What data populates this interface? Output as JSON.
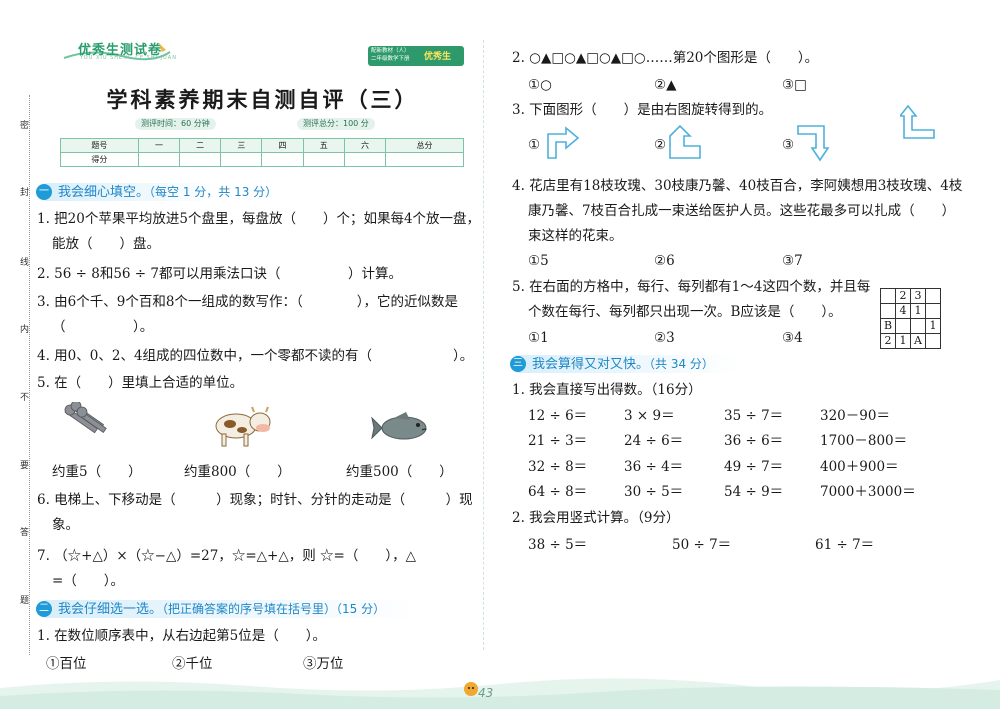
{
  "header": {
    "logo": "优秀生测试卷",
    "logo_sub": "YOU XIU SHENG CE SHI JUAN",
    "badge_left_line1": "配新教材（人）",
    "badge_left_line2": "二年级数学下册",
    "badge_right": "优秀生"
  },
  "title": "学科素养期末自测自评（三）",
  "meta": {
    "time": "测评时间：60 分钟",
    "total": "测评总分：100 分"
  },
  "score_table": {
    "row1": [
      "题号",
      "一",
      "二",
      "三",
      "四",
      "五",
      "六",
      "总分"
    ],
    "row2_label": "得分"
  },
  "side_labels": [
    "密",
    "封",
    "线",
    "内",
    "不",
    "要",
    "答",
    "题"
  ],
  "section1": {
    "num": "一",
    "title": "我会细心填空。",
    "note": "（每空 1 分，共 13 分）",
    "q1a": "1. 把20个苹果平均放进5个盘里，每盘放（　　）个；如果每4个放一盘，",
    "q1b": "能放（　　）盘。",
    "q2": "2. 56 ÷ 8和56 ÷ 7都可以用乘法口诀（　　　　　）计算。",
    "q3a": "3. 由6个千、9个百和8个一组成的数写作：（　　　　），它的近似数是",
    "q3b": "（　　　　　）。",
    "q4": "4. 用0、0、2、4组成的四位数中，一个零都不读的有（　　　　　　）。",
    "q5": "5. 在（　　）里填上合适的单位。",
    "q5_labels": [
      "约重5（　　）",
      "约重800（　　）",
      "约重500（　　）"
    ],
    "q6a": "6. 电梯上、下移动是（　　　）现象；时针、分针的走动是（　　　）现",
    "q6b": "象。",
    "q7a": "7. （☆+△）×（☆−△）=27，☆=△+△，则 ☆=（　　），△",
    "q7b": "=（　　）。"
  },
  "section2": {
    "num": "二",
    "title": "我会仔细选一选。",
    "note": "（把正确答案的序号填在括号里）（15 分）",
    "q1": "1. 在数位顺序表中，从右边起第5位是（　　）。",
    "q1_opts": [
      "①百位",
      "②千位",
      "③万位"
    ],
    "q2": "2. ○▲□○▲□○▲□○……第20个图形是（　　）。",
    "q2_opts": [
      "①○",
      "②▲",
      "③□"
    ],
    "q3": "3. 下面图形（　　）是由右图旋转得到的。",
    "q3_opts": [
      "①",
      "②",
      "③"
    ],
    "q4a": "4. 花店里有18枝玫瑰、30枝康乃馨、40枝百合，李阿姨想用3枝玫瑰、4枝",
    "q4b": "康乃馨、7枝百合扎成一束送给医护人员。这些花最多可以扎成（　　）",
    "q4c": "束这样的花束。",
    "q4_opts": [
      "①5",
      "②6",
      "③7"
    ],
    "q5a": "5. 在右面的方格中，每行、每列都有1～4这四个数，并且每",
    "q5b": "个数在每行、每列都只出现一次。B应该是（　　）。",
    "q5_opts": [
      "①1",
      "②3",
      "③4"
    ],
    "grid": [
      [
        "",
        "2",
        "3",
        ""
      ],
      [
        "",
        "4",
        "1",
        ""
      ],
      [
        "B",
        "",
        "",
        "1"
      ],
      [
        "2",
        "1",
        "A",
        ""
      ]
    ]
  },
  "section3": {
    "num": "三",
    "title": "我会算得又对又快。",
    "note": "（共 34 分）",
    "q1": "1. 我会直接写出得数。（16分）",
    "oral": [
      [
        "12 ÷ 6＝",
        "3 × 9＝",
        "35 ÷ 7＝",
        "320－90＝"
      ],
      [
        "21 ÷ 3＝",
        "24 ÷ 6＝",
        "36 ÷ 6＝",
        "1700－800＝"
      ],
      [
        "32 ÷ 8＝",
        "36 ÷ 4＝",
        "49 ÷ 7＝",
        "400＋900＝"
      ],
      [
        "64 ÷ 8＝",
        "30 ÷ 5＝",
        "54 ÷ 9＝",
        "7000＋3000＝"
      ]
    ],
    "q2": "2. 我会用竖式计算。（9分）",
    "vertical": [
      "38 ÷ 5＝",
      "50 ÷ 7＝",
      "61 ÷ 7＝"
    ]
  },
  "page_number": "43"
}
